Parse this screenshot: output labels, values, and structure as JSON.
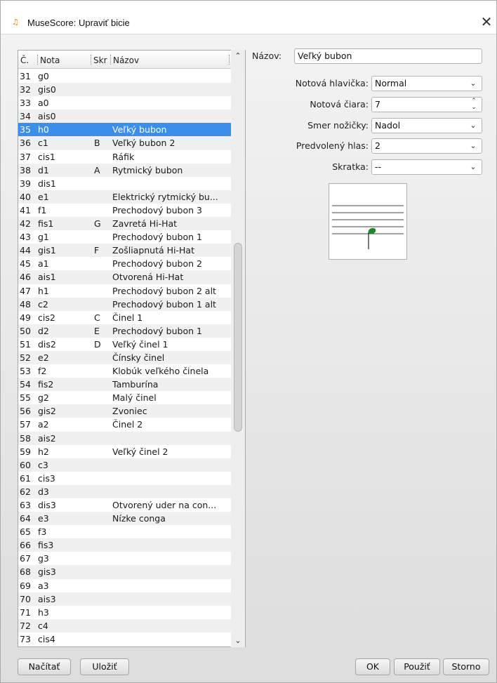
{
  "window": {
    "title": "MuseScore: Upraviť bicie",
    "icon": "musescore-icon",
    "close_glyph": "✕"
  },
  "table": {
    "columns": [
      "Č.",
      "Nota",
      "Skr",
      "Názov"
    ],
    "selected_row": 4,
    "rows": [
      [
        "31",
        "g0",
        "",
        ""
      ],
      [
        "32",
        "gis0",
        "",
        ""
      ],
      [
        "33",
        "a0",
        "",
        ""
      ],
      [
        "34",
        "ais0",
        "",
        ""
      ],
      [
        "35",
        "h0",
        "",
        "Veľký bubon"
      ],
      [
        "36",
        "c1",
        "B",
        "Veľký bubon 2"
      ],
      [
        "37",
        "cis1",
        "",
        "Ráfik"
      ],
      [
        "38",
        "d1",
        "A",
        "Rytmický bubon"
      ],
      [
        "39",
        "dis1",
        "",
        ""
      ],
      [
        "40",
        "e1",
        "",
        "Elektrický rytmický bu..."
      ],
      [
        "41",
        "f1",
        "",
        "Prechodový bubon 3"
      ],
      [
        "42",
        "fis1",
        "G",
        "Zavretá Hi-Hat"
      ],
      [
        "43",
        "g1",
        "",
        "Prechodový bubon 1"
      ],
      [
        "44",
        "gis1",
        "F",
        "Zošliapnutá Hi-Hat"
      ],
      [
        "45",
        "a1",
        "",
        "Prechodový bubon 2"
      ],
      [
        "46",
        "ais1",
        "",
        "Otvorená Hi-Hat"
      ],
      [
        "47",
        "h1",
        "",
        "Prechodový bubon 2 alt"
      ],
      [
        "48",
        "c2",
        "",
        "Prechodový bubon 1 alt"
      ],
      [
        "49",
        "cis2",
        "C",
        "Činel 1"
      ],
      [
        "50",
        "d2",
        "E",
        "Prechodový bubon 1"
      ],
      [
        "51",
        "dis2",
        "D",
        "Veľký činel 1"
      ],
      [
        "52",
        "e2",
        "",
        "Čínsky činel"
      ],
      [
        "53",
        "f2",
        "",
        "Klobúk veľkého činela"
      ],
      [
        "54",
        "fis2",
        "",
        "Tamburína"
      ],
      [
        "55",
        "g2",
        "",
        "Malý činel"
      ],
      [
        "56",
        "gis2",
        "",
        "Zvoniec"
      ],
      [
        "57",
        "a2",
        "",
        "Činel 2"
      ],
      [
        "58",
        "ais2",
        "",
        ""
      ],
      [
        "59",
        "h2",
        "",
        "Veľký činel 2"
      ],
      [
        "60",
        "c3",
        "",
        ""
      ],
      [
        "61",
        "cis3",
        "",
        ""
      ],
      [
        "62",
        "d3",
        "",
        ""
      ],
      [
        "63",
        "dis3",
        "",
        "Otvorený uder na con..."
      ],
      [
        "64",
        "e3",
        "",
        "Nízke conga"
      ],
      [
        "65",
        "f3",
        "",
        ""
      ],
      [
        "66",
        "fis3",
        "",
        ""
      ],
      [
        "67",
        "g3",
        "",
        ""
      ],
      [
        "68",
        "gis3",
        "",
        ""
      ],
      [
        "69",
        "a3",
        "",
        ""
      ],
      [
        "70",
        "ais3",
        "",
        ""
      ],
      [
        "71",
        "h3",
        "",
        ""
      ],
      [
        "72",
        "c4",
        "",
        ""
      ],
      [
        "73",
        "cis4",
        "",
        ""
      ]
    ],
    "scroll": {
      "up_glyph": "⌃",
      "down_glyph": "⌄",
      "position_fraction": 0.47,
      "visible_fraction": 0.33
    }
  },
  "form": {
    "name_label": "Názov:",
    "name_value": "Veľký bubon",
    "notehead_label": "Notová hlavička:",
    "notehead_value": "Normal",
    "line_label": "Notová čiara:",
    "line_value": "7",
    "stem_label": "Smer nožičky:",
    "stem_value": "Nadol",
    "voice_label": "Predvolený hlas:",
    "voice_value": "2",
    "shortcut_label": "Skratka:",
    "shortcut_value": "--",
    "combo_arrow": "⌄",
    "spin_up": "⌃",
    "spin_down": "⌄"
  },
  "preview": {
    "staff_lines": 5,
    "note_color": "#1a8a2a",
    "note_line": 7
  },
  "buttons": {
    "load": "Načítať",
    "save": "Uložiť",
    "ok": "OK",
    "apply": "Použiť",
    "cancel": "Storno"
  },
  "colors": {
    "selection": "#3b8eea",
    "icon": "#e08a00"
  }
}
